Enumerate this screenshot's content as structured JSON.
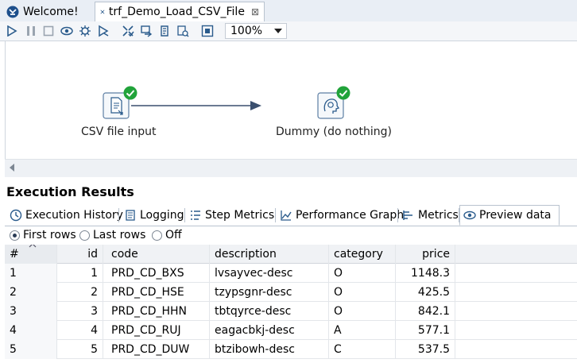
{
  "tabs": [
    {
      "label": "Welcome!",
      "icon": "spoon-logo-icon",
      "active": false
    },
    {
      "label": "trf_Demo_Load_CSV_File",
      "icon": "transformation-icon",
      "active": true,
      "close": "⊠"
    }
  ],
  "toolbar": {
    "icons": [
      "run-icon",
      "pause-icon",
      "stop-icon",
      "preview-icon",
      "debug-icon",
      "replay-icon",
      "verify-icon",
      "impact-icon",
      "sql-icon",
      "explore-db-icon",
      "grid-toggle-icon"
    ],
    "zoom": "100%"
  },
  "canvas": {
    "steps": [
      {
        "label": "CSV file input",
        "icon": "csv-file-icon",
        "status": "ok"
      },
      {
        "label": "Dummy (do nothing)",
        "icon": "dummy-icon",
        "status": "ok"
      }
    ]
  },
  "execution": {
    "title": "Execution Results",
    "tabs": [
      {
        "label": "Execution History",
        "icon": "history-icon"
      },
      {
        "label": "Logging",
        "icon": "logging-icon"
      },
      {
        "label": "Step Metrics",
        "icon": "step-metrics-icon"
      },
      {
        "label": "Performance Graph",
        "icon": "perf-graph-icon"
      },
      {
        "label": "Metrics",
        "icon": "metrics-icon"
      },
      {
        "label": "Preview data",
        "icon": "eye-icon",
        "active": true
      }
    ],
    "radios": [
      {
        "label": "First rows",
        "checked": true
      },
      {
        "label": "Last rows",
        "checked": false
      },
      {
        "label": "Off",
        "checked": false
      }
    ],
    "table": {
      "columns": [
        "#",
        "id",
        "code",
        "description",
        "category",
        "price"
      ],
      "rows": [
        [
          "1",
          "1",
          "PRD_CD_BXS",
          "lvsayvec-desc",
          "O",
          "1148.3"
        ],
        [
          "2",
          "2",
          "PRD_CD_HSE",
          "tzypsgnr-desc",
          "O",
          "425.5"
        ],
        [
          "3",
          "3",
          "PRD_CD_HHN",
          "tbtqyrce-desc",
          "O",
          "842.1"
        ],
        [
          "4",
          "4",
          "PRD_CD_RUJ",
          "eagacbkj-desc",
          "A",
          "577.1"
        ],
        [
          "5",
          "5",
          "PRD_CD_DUW",
          "btzibowh-desc",
          "C",
          "537.5"
        ]
      ]
    }
  },
  "colors": {
    "accent": "#2a5b8c",
    "ok": "#21a33a",
    "link": "#3a4f6e"
  }
}
